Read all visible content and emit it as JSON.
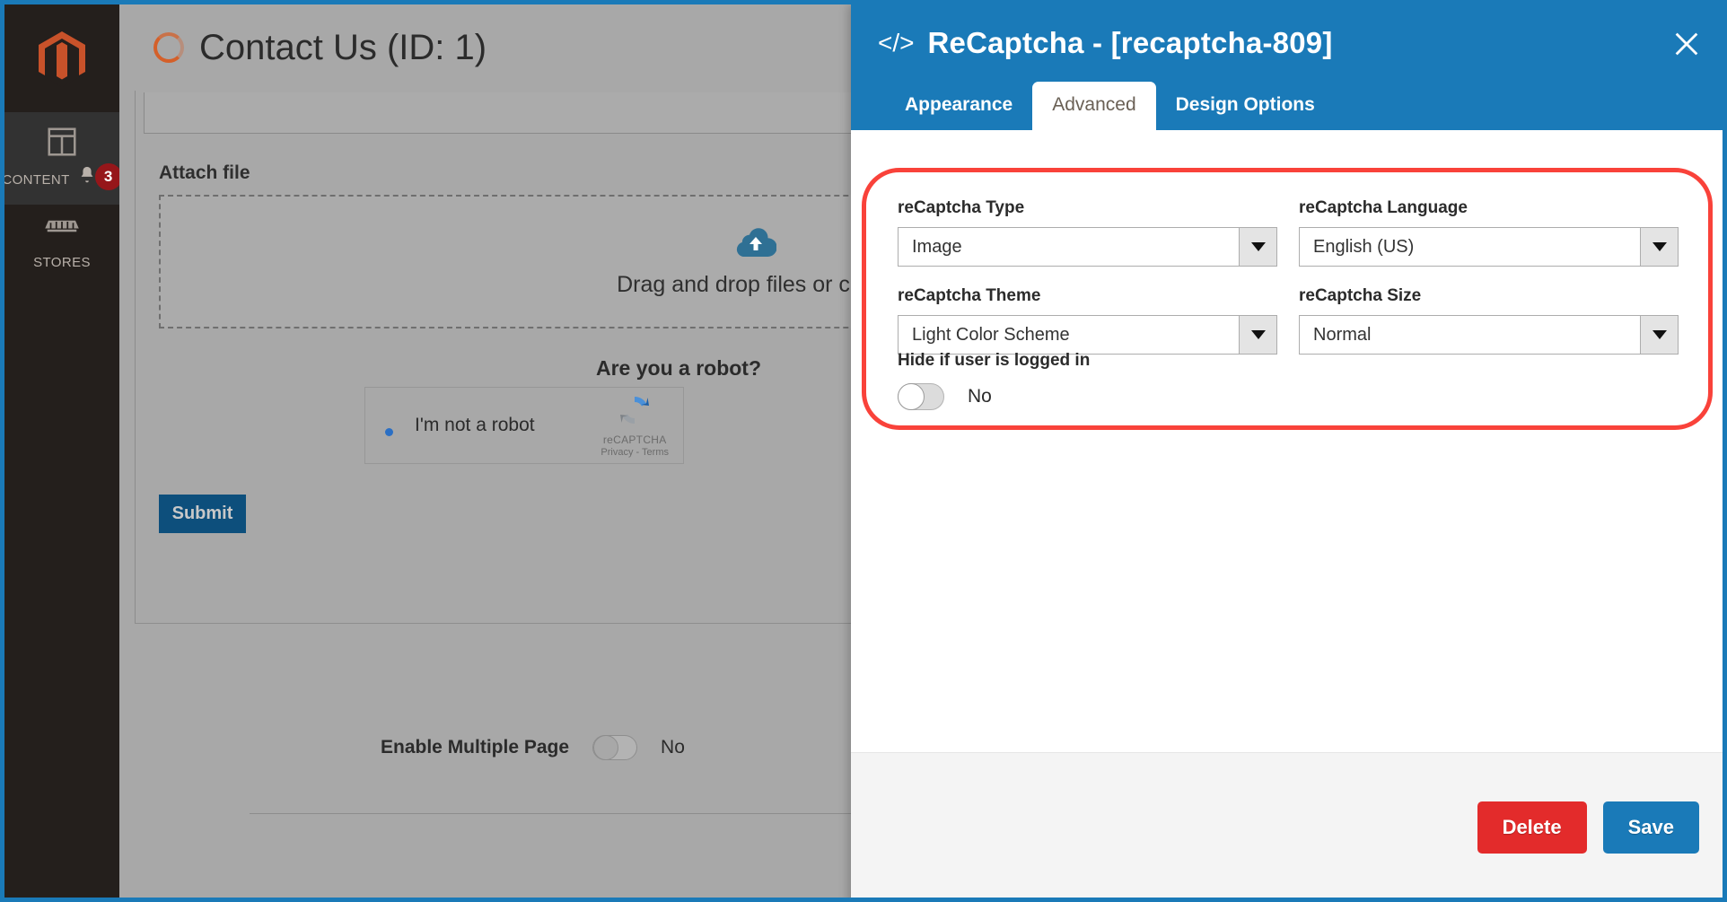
{
  "colors": {
    "accent_blue": "#1a7ab8",
    "highlight_red": "#f9423a",
    "delete_red": "#e32b2b",
    "sidebar_dark": "#241f1c",
    "magento_orange": "#d4602a"
  },
  "sidebar": {
    "logo_name": "magento-logo-icon",
    "items": [
      {
        "label": "Content",
        "icon": "content-layout-icon",
        "badge": "3",
        "active": true
      },
      {
        "label": "Stores",
        "icon": "store-icon",
        "badge": "",
        "active": false
      }
    ]
  },
  "page": {
    "title": "Contact Us (ID: 1)",
    "spinner_icon": "loading-spinner-icon",
    "attach_label": "Attach file",
    "dropzone_text": "Drag and drop files or click t",
    "dropzone_icon": "cloud-upload-icon",
    "robot_question": "Are you a robot?",
    "recaptcha": {
      "checkbox_label": "I'm not a robot",
      "brand": "reCAPTCHA",
      "legal": "Privacy - Terms",
      "logo_icon": "recaptcha-logo-icon"
    },
    "submit_label": "Submit",
    "multi_page": {
      "label": "Enable Multiple Page",
      "value": "No"
    }
  },
  "panel": {
    "icon": "code-brackets-icon",
    "title": "ReCaptcha - [recaptcha-809]",
    "close_icon": "close-icon",
    "tabs": [
      {
        "label": "Appearance",
        "active": false
      },
      {
        "label": "Advanced",
        "active": true
      },
      {
        "label": "Design Options",
        "active": false
      }
    ],
    "fields": [
      {
        "label": "reCaptcha Type",
        "value": "Image",
        "name": "recaptcha-type"
      },
      {
        "label": "reCaptcha Language",
        "value": "English (US)",
        "name": "recaptcha-language"
      },
      {
        "label": "reCaptcha Theme",
        "value": "Light Color Scheme",
        "name": "recaptcha-theme"
      },
      {
        "label": "reCaptcha Size",
        "value": "Normal",
        "name": "recaptcha-size"
      }
    ],
    "hide_if_logged_in": {
      "label": "Hide if user is logged in",
      "value": "No"
    },
    "footer": {
      "delete_label": "Delete",
      "save_label": "Save"
    }
  }
}
